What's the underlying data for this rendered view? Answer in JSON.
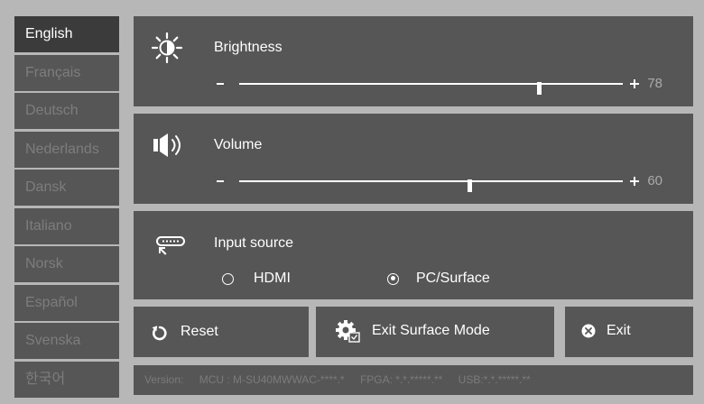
{
  "languages": [
    {
      "label": "English",
      "selected": true
    },
    {
      "label": "Français",
      "selected": false
    },
    {
      "label": "Deutsch",
      "selected": false
    },
    {
      "label": "Nederlands",
      "selected": false
    },
    {
      "label": "Dansk",
      "selected": false
    },
    {
      "label": "Italiano",
      "selected": false
    },
    {
      "label": "Norsk",
      "selected": false
    },
    {
      "label": "Español",
      "selected": false
    },
    {
      "label": "Svenska",
      "selected": false
    },
    {
      "label": "한국어",
      "selected": false
    }
  ],
  "brightness": {
    "label": "Brightness",
    "value": 78,
    "max": 100,
    "icon": "brightness-icon"
  },
  "volume": {
    "label": "Volume",
    "value": 60,
    "max": 100,
    "icon": "speaker-icon"
  },
  "input_source": {
    "label": "Input source",
    "icon": "input-source-icon",
    "options": [
      "HDMI",
      "PC/Surface"
    ],
    "selected": "PC/Surface"
  },
  "buttons": {
    "reset": "Reset",
    "exit_surface": "Exit Surface Mode",
    "exit": "Exit"
  },
  "version": {
    "prefix": "Version:",
    "mcu": "MCU : M-SU40MWWAC-****.*",
    "fpga": "FPGA: *.*.*****.**",
    "usb": "USB:*.*.*****.**"
  },
  "colors": {
    "panel": "#565656",
    "background": "#b7b7b7",
    "selected": "#3b3b3b"
  }
}
